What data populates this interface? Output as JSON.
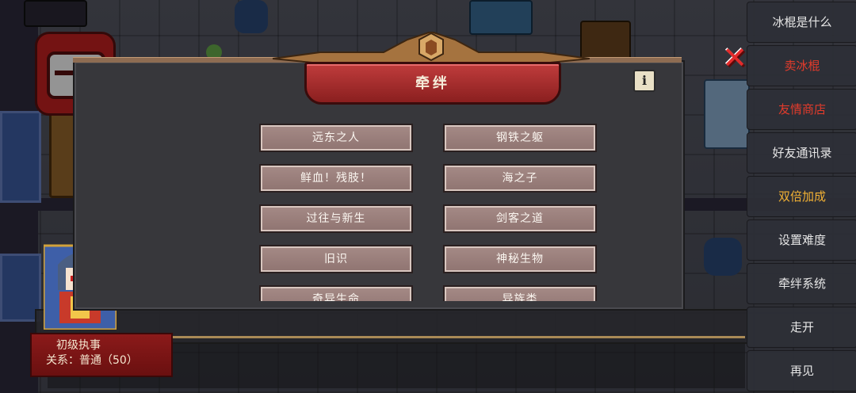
{
  "dialog": {
    "title": "牵绊",
    "info_icon": "i",
    "close_icon": "✕",
    "bond_items": [
      "远东之人",
      "钢铁之躯",
      "鲜血！残肢！",
      "海之子",
      "过往与新生",
      "剑客之道",
      "旧识",
      "神秘生物",
      "奇异生命",
      "异族类"
    ]
  },
  "npc": {
    "name": "初级执事",
    "relation": "关系：普通（50）"
  },
  "menu": {
    "items": [
      {
        "label": "冰棍是什么",
        "color": "#e6e6e6"
      },
      {
        "label": "卖冰棍",
        "color": "#e33b2b"
      },
      {
        "label": "友情商店",
        "color": "#e33b2b"
      },
      {
        "label": "好友通讯录",
        "color": "#e6e6e6"
      },
      {
        "label": "双倍加成",
        "color": "#f2b134"
      },
      {
        "label": "设置难度",
        "color": "#e6e6e6"
      },
      {
        "label": "牵绊系统",
        "color": "#e6e6e6"
      },
      {
        "label": "走开",
        "color": "#e6e6e6"
      },
      {
        "label": "再见",
        "color": "#e6e6e6"
      }
    ]
  }
}
